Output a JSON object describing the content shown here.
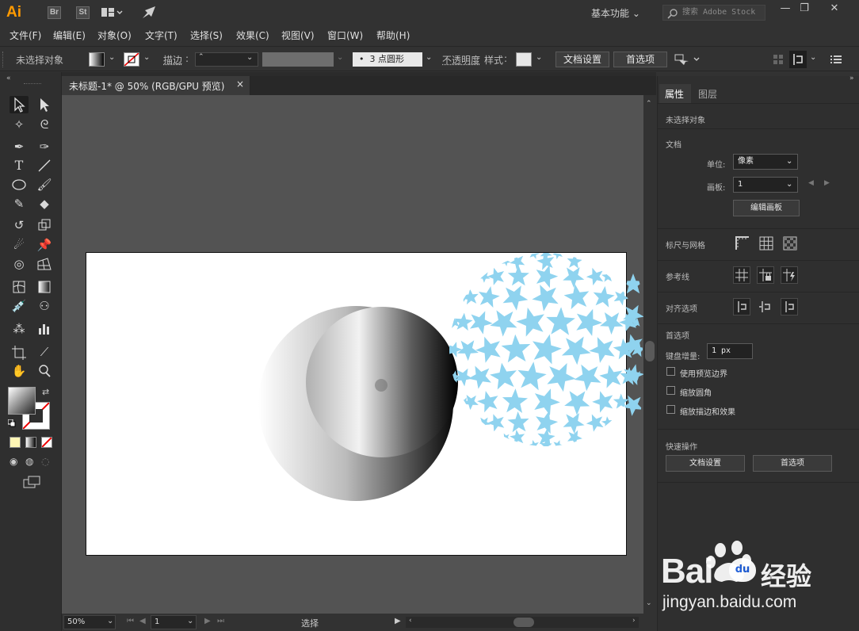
{
  "app": {
    "logo": "Ai",
    "badges": [
      "Br",
      "St"
    ],
    "workspace": "基本功能",
    "search_placeholder": "搜索 Adobe Stock",
    "window_controls": [
      "minimize-icon",
      "restore-icon",
      "close-icon"
    ]
  },
  "menu": [
    "文件(F)",
    "编辑(E)",
    "对象(O)",
    "文字(T)",
    "选择(S)",
    "效果(C)",
    "视图(V)",
    "窗口(W)",
    "帮助(H)"
  ],
  "control": {
    "selection_status": "未选择对象",
    "stroke_label": "描边",
    "brush_label": "3 点圆形",
    "opacity_label": "不透明度",
    "style_label": "样式",
    "doc_setup_button": "文档设置",
    "prefs_button": "首选项"
  },
  "document": {
    "tab_title": "未标题-1* @ 50% (RGB/GPU 预览)",
    "close_label": "×"
  },
  "status": {
    "zoom": "50%",
    "artboard": "1",
    "tool": "选择"
  },
  "panel": {
    "tabs": [
      "属性",
      "图层"
    ],
    "active_tab": "属性",
    "selection_status": "未选择对象",
    "document_section": "文档",
    "units_label": "单位:",
    "units_value": "像素",
    "artboard_label": "画板:",
    "artboard_value": "1",
    "edit_artboard_button": "编辑画板",
    "rulers_grids": "标尺与网格",
    "guides": "参考线",
    "snap_options": "对齐选项",
    "preferences": "首选项",
    "keyboard_increment_label": "键盘增量:",
    "keyboard_increment_value": "1 px",
    "checkboxes": [
      "使用预览边界",
      "缩放圆角",
      "缩放描边和效果"
    ],
    "quick_actions": "快速操作",
    "quick_doc_setup": "文档设置",
    "quick_prefs": "首选项"
  },
  "watermark": {
    "brand": "Bai",
    "brand_sub": "经验",
    "url": "jingyan.baidu.com"
  },
  "colors": {
    "accent": "#ff9a00",
    "star_blue": "#8fd3ef",
    "canvas": "#535353"
  }
}
